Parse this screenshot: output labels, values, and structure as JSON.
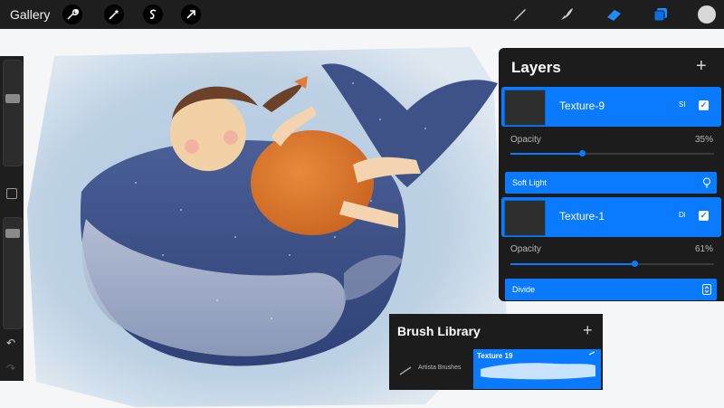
{
  "topbar": {
    "gallery_label": "Gallery",
    "tools_left": [
      {
        "name": "wrench-icon"
      },
      {
        "name": "magic-wand-icon"
      },
      {
        "name": "selection-icon"
      },
      {
        "name": "transform-arrow-icon"
      }
    ],
    "tools_right": [
      {
        "name": "brush-icon"
      },
      {
        "name": "smudge-icon"
      },
      {
        "name": "eraser-icon"
      },
      {
        "name": "layers-icon"
      }
    ],
    "current_color": "#d8d8d8",
    "accent_color": "#0a7bff"
  },
  "layers_panel": {
    "title": "Layers",
    "layers": [
      {
        "name": "Texture-9",
        "mode_short": "SI",
        "visible": true,
        "opacity_label": "Opacity",
        "opacity_value": "35%",
        "opacity": 0.35,
        "blend_mode": "Soft Light"
      },
      {
        "name": "Texture-1",
        "mode_short": "Di",
        "visible": true,
        "opacity_label": "Opacity",
        "opacity_value": "61%",
        "opacity": 0.61,
        "blend_mode": "Divide"
      }
    ]
  },
  "brush_library": {
    "title": "Brush Library",
    "category": "Artista Brushes",
    "selected_brush": "Texture 19"
  },
  "sidebar": {
    "brush_size": 0.65,
    "brush_opacity": 0.1
  }
}
